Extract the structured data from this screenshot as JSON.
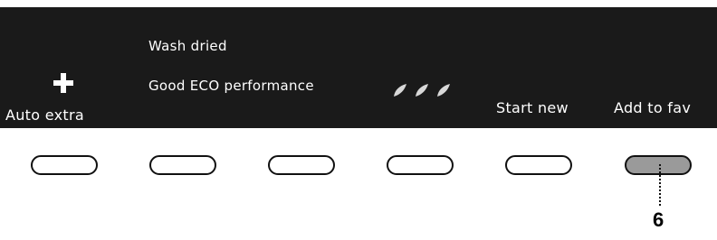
{
  "display": {
    "line1": "Wash dried",
    "line2": "Good ECO performance",
    "auto_extra_label": "Auto extra",
    "start_new_label": "Start new",
    "add_to_fav_label": "Add to fav",
    "plus_icon": "plus-icon",
    "eco_icons": [
      "leaf-icon",
      "leaf-icon",
      "leaf-icon"
    ],
    "eco_rating": 3
  },
  "buttons": {
    "count": 6,
    "selected_index": 6
  },
  "callout": {
    "number": "6"
  },
  "colors": {
    "display_bg": "#1a1a1a",
    "selected_button": "#9a9a9a"
  }
}
